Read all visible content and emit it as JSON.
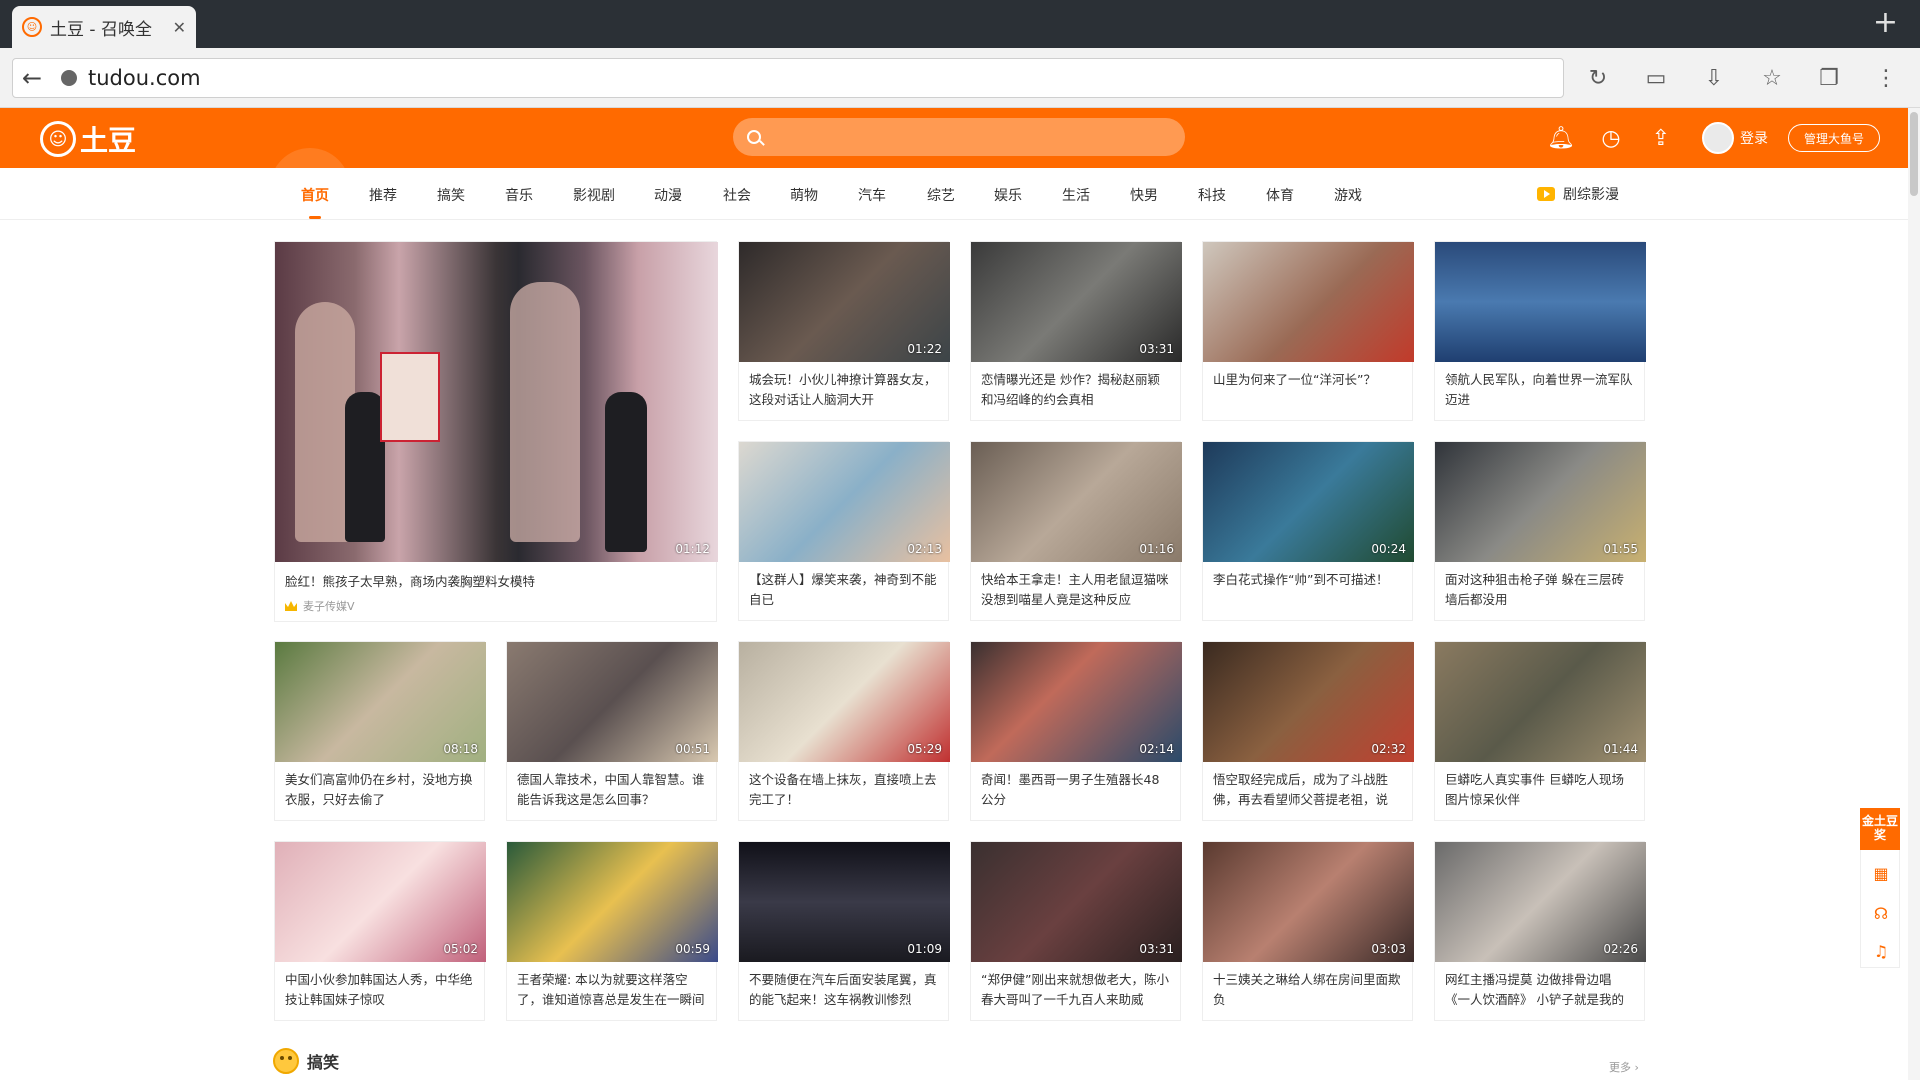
{
  "browser": {
    "tab_title": "土豆 - 召唤全",
    "url": "tudou.com"
  },
  "site": {
    "logo_text": "土豆",
    "search_placeholder": "",
    "login_label": "登录",
    "manager_button": "管理大鱼号",
    "accent_color": "#ff6a00"
  },
  "nav": {
    "items": [
      "首页",
      "推荐",
      "搞笑",
      "音乐",
      "影视剧",
      "动漫",
      "社会",
      "萌物",
      "汽车",
      "综艺",
      "娱乐",
      "生活",
      "快男",
      "科技",
      "体育",
      "游戏"
    ],
    "active": "首页",
    "special": "剧综影漫"
  },
  "featured": {
    "duration": "01:12",
    "title": "脸红！熊孩子太早熟，商场内袭胸塑料女模特",
    "uploader": "麦子传媒V"
  },
  "videos": [
    {
      "duration": "01:22",
      "title": "城会玩！小伙儿神撩计算器女友，这段对话让人脑洞大开"
    },
    {
      "duration": "03:31",
      "title": "恋情曝光还是 炒作？揭秘赵丽颖和冯绍峰的约会真相"
    },
    {
      "duration": "",
      "title": "山里为何来了一位“洋河长”？"
    },
    {
      "duration": "",
      "title": "领航人民军队，向着世界一流军队迈进"
    },
    {
      "duration": "02:13",
      "title": "【这群人】爆笑来袭，神奇到不能自已"
    },
    {
      "duration": "01:16",
      "title": "快给本王拿走！主人用老鼠逗猫咪没想到喵星人竟是这种反应"
    },
    {
      "duration": "00:24",
      "title": "李白花式操作“帅”到不可描述！"
    },
    {
      "duration": "01:55",
      "title": "面对这种狙击枪子弹 躲在三层砖墙后都没用"
    },
    {
      "duration": "08:18",
      "title": "美女们高富帅仍在乡村，没地方换衣服，只好去偷了"
    },
    {
      "duration": "00:51",
      "title": "德国人靠技术，中国人靠智慧。谁能告诉我这是怎么回事？"
    },
    {
      "duration": "05:29",
      "title": "这个设备在墙上抹灰，直接喷上去完工了！"
    },
    {
      "duration": "02:14",
      "title": "奇闻！墨西哥一男子生殖器长48公分"
    },
    {
      "duration": "02:32",
      "title": "悟空取经完成后，成为了斗战胜佛，再去看望师父菩提老祖，说"
    },
    {
      "duration": "01:44",
      "title": "巨蟒吃人真实事件 巨蟒吃人现场图片惊呆伙伴"
    },
    {
      "duration": "05:02",
      "title": "中国小伙参加韩国达人秀，中华绝技让韩国妹子惊叹"
    },
    {
      "duration": "00:59",
      "title": "王者荣耀: 本以为就要这样落空了，谁知道惊喜总是发生在一瞬间"
    },
    {
      "duration": "01:09",
      "title": "不要随便在汽车后面安装尾翼，真的能飞起来！这车祸教训惨烈"
    },
    {
      "duration": "03:31",
      "title": "“郑伊健”刚出来就想做老大，陈小春大哥叫了一千九百人来助威"
    },
    {
      "duration": "03:03",
      "title": "十三姨关之琳给人绑在房间里面欺负"
    },
    {
      "duration": "02:26",
      "title": "网红主播冯提莫 边做排骨边唱《一人饮酒醉》 小铲子就是我的麦"
    }
  ],
  "section": {
    "title": "搞笑",
    "more_label": "更多 ›"
  },
  "float_panel": {
    "label": "金土豆奖"
  }
}
